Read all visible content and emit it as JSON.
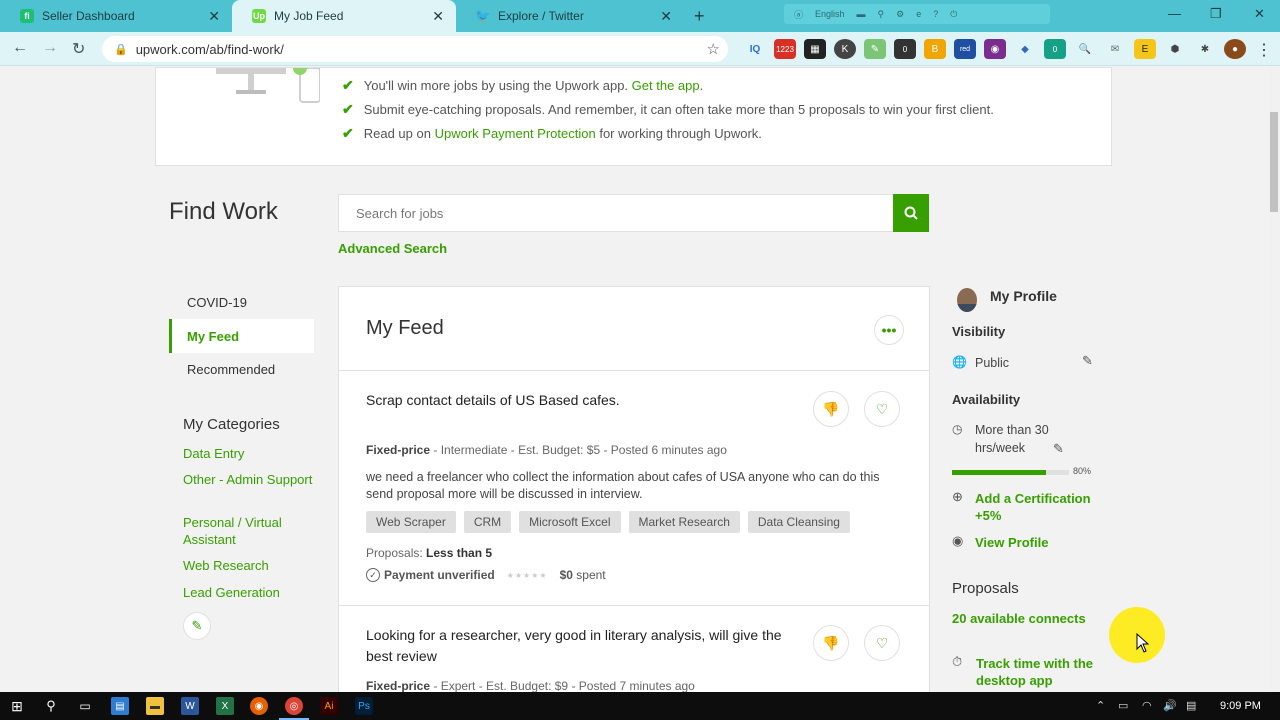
{
  "browser": {
    "tabs": [
      {
        "title": "Seller Dashboard",
        "favicon": "fiverr-icon",
        "color": "#1dbf73"
      },
      {
        "title": "My Job Feed",
        "favicon": "upwork-icon",
        "color": "#6fda44"
      },
      {
        "title": "Explore / Twitter",
        "favicon": "twitter-icon",
        "color": "#1da1f2"
      }
    ],
    "language_label": "English",
    "url": "upwork.com/ab/find-work/",
    "ext_badge_1": "1223",
    "ext_badge_2": "0",
    "ext_badge_3": "0"
  },
  "tips": {
    "items": [
      {
        "text": "You'll win more jobs by using the Upwork app.",
        "link": "Get the app",
        "suffix": "."
      },
      {
        "text": "Submit eye-catching proposals. And remember, it can often take more than 5 proposals to win your first client.",
        "link": "",
        "suffix": ""
      },
      {
        "text": "Read up on",
        "link": "Upwork Payment Protection",
        "suffix": "for working through Upwork."
      }
    ]
  },
  "find_work": {
    "title": "Find Work",
    "search_placeholder": "Search for jobs",
    "advanced_search": "Advanced Search"
  },
  "left_nav": {
    "items": [
      "COVID-19",
      "My Feed",
      "Recommended"
    ],
    "categories_title": "My Categories",
    "categories": [
      "Data Entry",
      "Other - Admin Support",
      "Personal / Virtual Assistant",
      "Web Research",
      "Lead Generation"
    ]
  },
  "feed": {
    "title": "My Feed",
    "jobs": [
      {
        "title": "Scrap contact details of US Based cafes.",
        "type": "Fixed-price",
        "meta": "- Intermediate - Est. Budget: $5 - Posted 6 minutes ago",
        "description": "we need a freelancer who collect the information about cafes of USA anyone who can do this send proposal more will be discussed in interview.",
        "skills": [
          "Web Scraper",
          "CRM",
          "Microsoft Excel",
          "Market Research",
          "Data Cleansing"
        ],
        "proposals_label": "Proposals:",
        "proposals_value": "Less than 5",
        "payment": "Payment unverified",
        "spent_amount": "$0",
        "spent_label": "spent"
      },
      {
        "title": "Looking for a researcher, very good in literary analysis, will give the best review",
        "type": "Fixed-price",
        "meta": "- Expert - Est. Budget: $9 - Posted 7 minutes ago"
      }
    ]
  },
  "profile": {
    "title": "My Profile",
    "visibility_label": "Visibility",
    "visibility_value": "Public",
    "availability_label": "Availability",
    "availability_value": "More than 30 hrs/week",
    "completeness": 0.8,
    "completeness_label": "80%",
    "add_certification": "Add a Certification +5%",
    "view_profile": "View Profile",
    "proposals_title": "Proposals",
    "connects": "20 available connects",
    "track_time": "Track time with the desktop app"
  },
  "taskbar": {
    "time": "9:09 PM"
  },
  "colors": {
    "accent": "#37a000",
    "titlebar": "#4ec2d0",
    "addressbar": "#dff4f7"
  }
}
